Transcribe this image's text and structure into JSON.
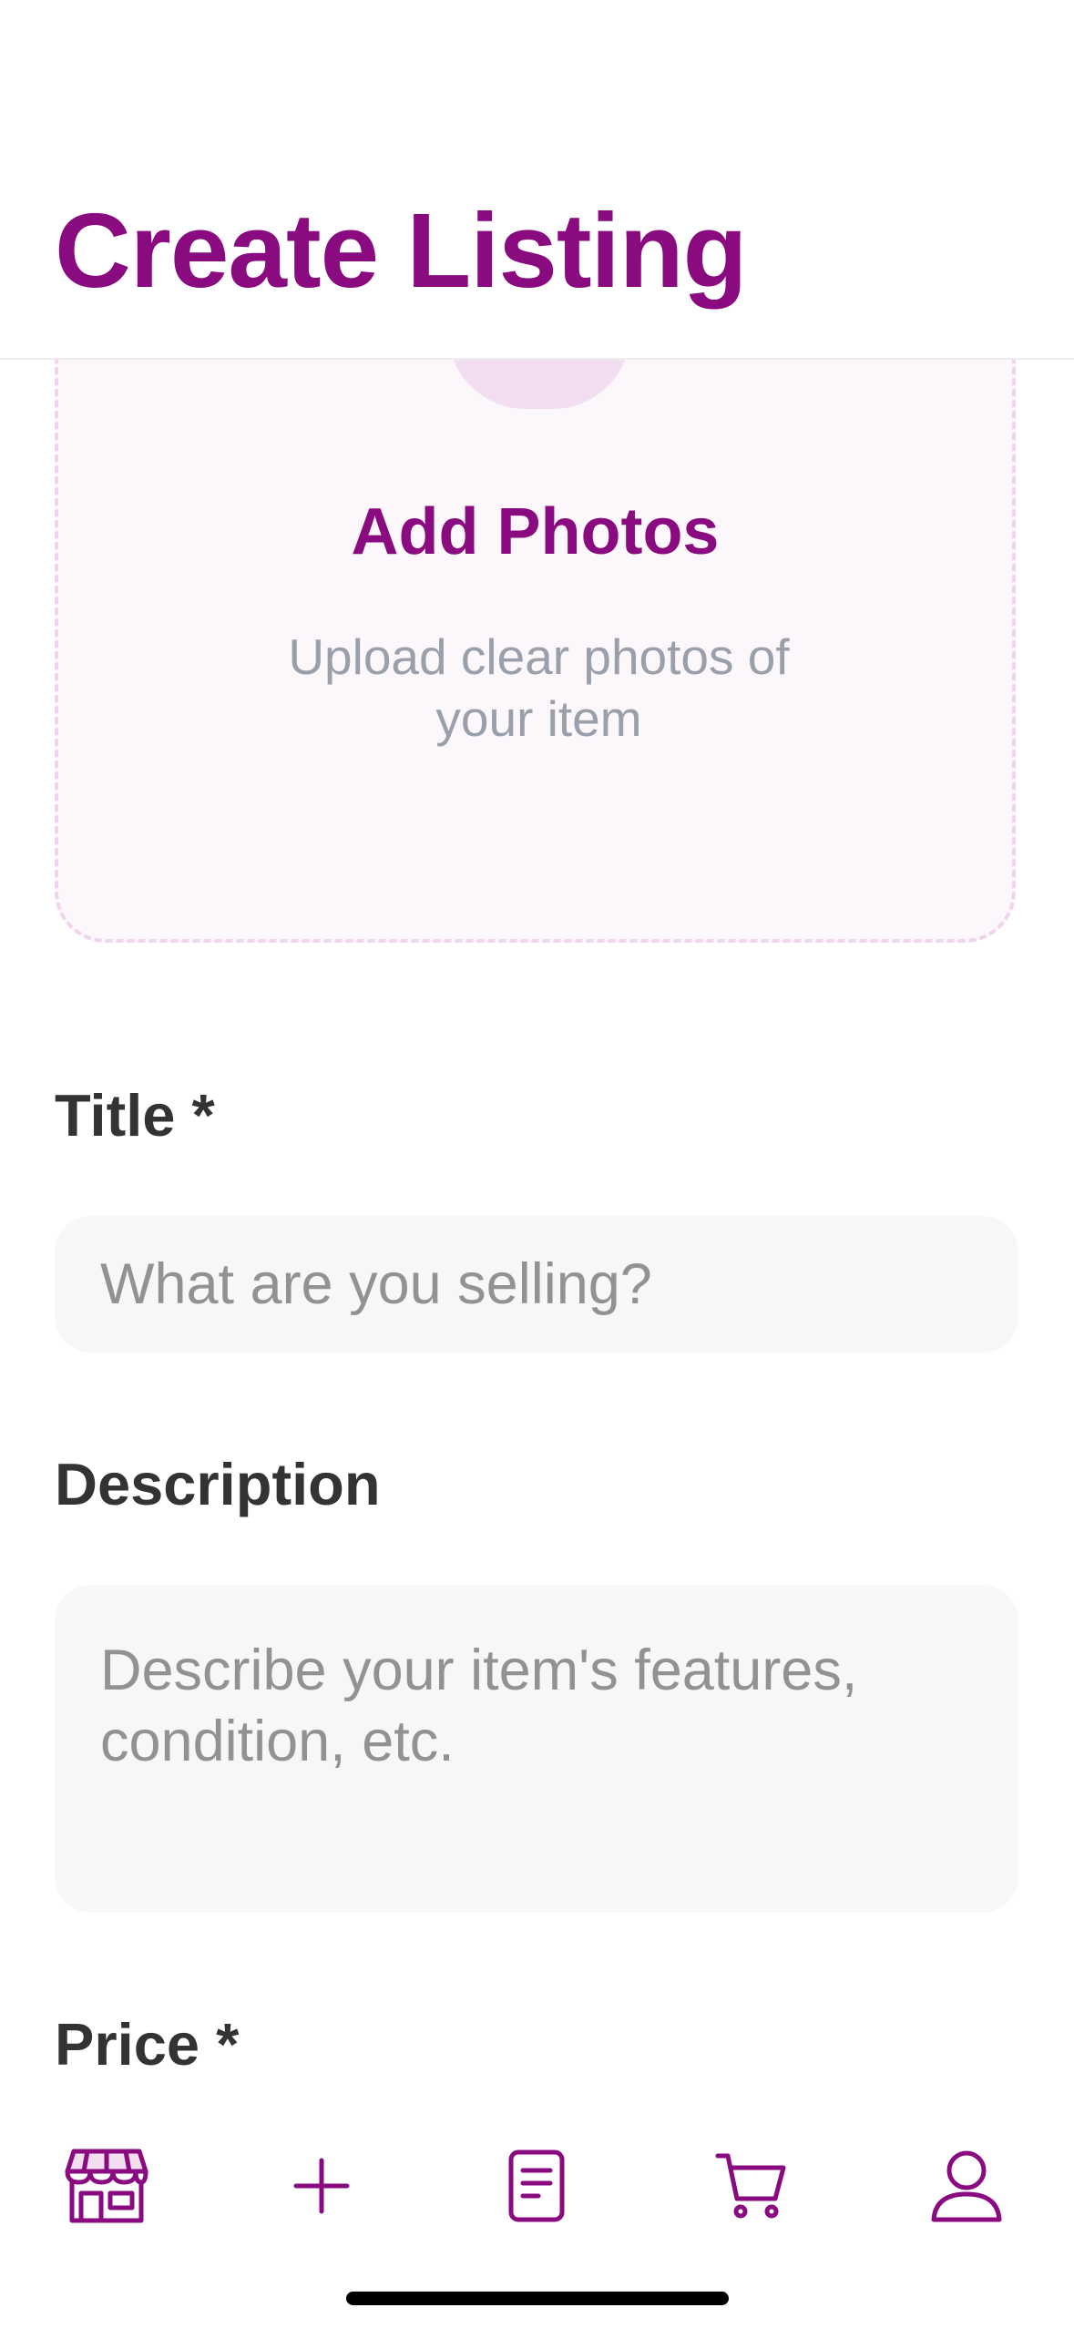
{
  "header": {
    "title": "Create Listing"
  },
  "photos": {
    "title": "Add Photos",
    "subtitle": "Upload clear photos of your item",
    "icon": "camera-icon"
  },
  "form": {
    "title_label": "Title *",
    "title_placeholder": "What are you selling?",
    "title_value": "",
    "description_label": "Description",
    "description_placeholder": "Describe your item's features, condition, etc.",
    "description_value": "",
    "price_label": "Price *"
  },
  "tabbar": {
    "items": [
      {
        "name": "marketplace",
        "icon": "storefront-icon",
        "active": true
      },
      {
        "name": "create",
        "icon": "plus-icon",
        "active": false
      },
      {
        "name": "listings",
        "icon": "document-icon",
        "active": false
      },
      {
        "name": "cart",
        "icon": "cart-icon",
        "active": false
      },
      {
        "name": "profile",
        "icon": "person-icon",
        "active": false
      }
    ]
  },
  "colors": {
    "accent": "#8a0a80",
    "text": "#333333",
    "placeholder": "#929292",
    "input_bg": "#f7f7f7",
    "photo_box_bg": "#fbf7fa",
    "photo_box_border": "#f0d4ee"
  }
}
